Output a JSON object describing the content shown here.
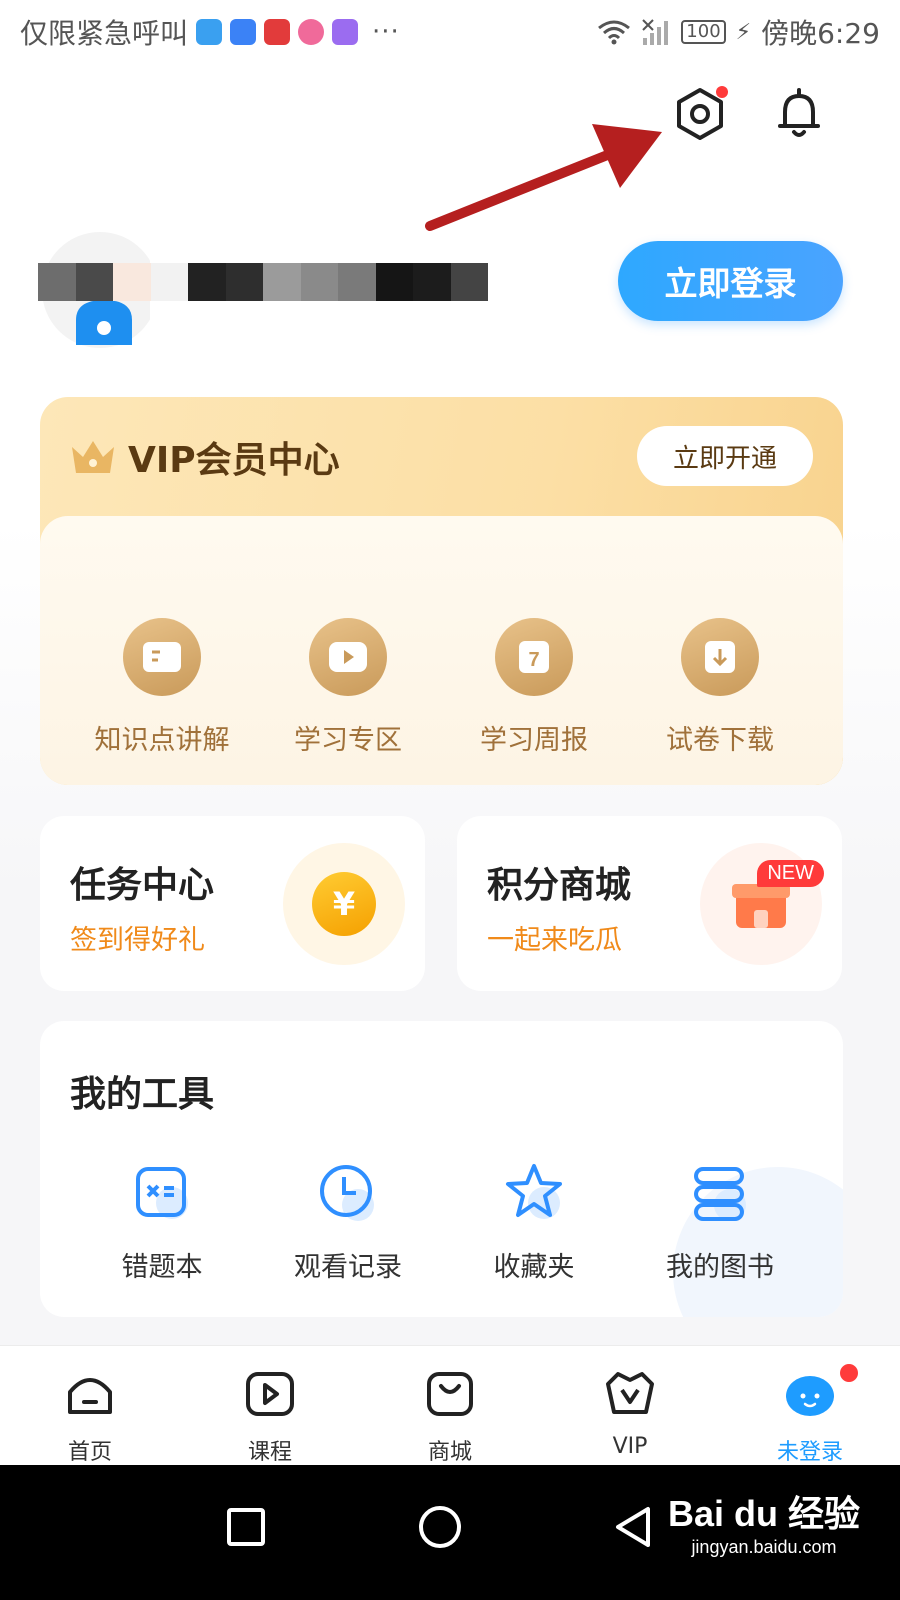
{
  "status_bar": {
    "carrier_text": "仅限紧急呼叫",
    "more": "···",
    "battery": "100",
    "time": "傍晚6:29"
  },
  "profile": {
    "login_button": "立即登录"
  },
  "vip": {
    "title": "VIP会员中心",
    "open_button": "立即开通",
    "items": [
      {
        "label": "知识点讲解",
        "glyph": "≡"
      },
      {
        "label": "学习专区",
        "glyph": "▶"
      },
      {
        "label": "学习周报",
        "glyph": "7"
      },
      {
        "label": "试卷下载",
        "glyph": "↓"
      }
    ]
  },
  "task_center": {
    "title": "任务中心",
    "subtitle": "签到得好礼",
    "coin": "¥"
  },
  "points_mall": {
    "title": "积分商城",
    "subtitle": "一起来吃瓜",
    "badge": "NEW"
  },
  "tools": {
    "title": "我的工具",
    "items": [
      {
        "label": "错题本"
      },
      {
        "label": "观看记录"
      },
      {
        "label": "收藏夹"
      },
      {
        "label": "我的图书"
      }
    ]
  },
  "tabbar": {
    "items": [
      {
        "label": "首页"
      },
      {
        "label": "课程"
      },
      {
        "label": "商城"
      },
      {
        "label": "VIP"
      },
      {
        "label": "未登录"
      }
    ]
  },
  "watermark": {
    "logo": "Bai du 经验",
    "url": "jingyan.baidu.com"
  },
  "colors": {
    "accent": "#1e9cff",
    "vip_gold": "#c99a5a",
    "orange": "#f08a1a",
    "red_dot": "#ff3b3b"
  }
}
